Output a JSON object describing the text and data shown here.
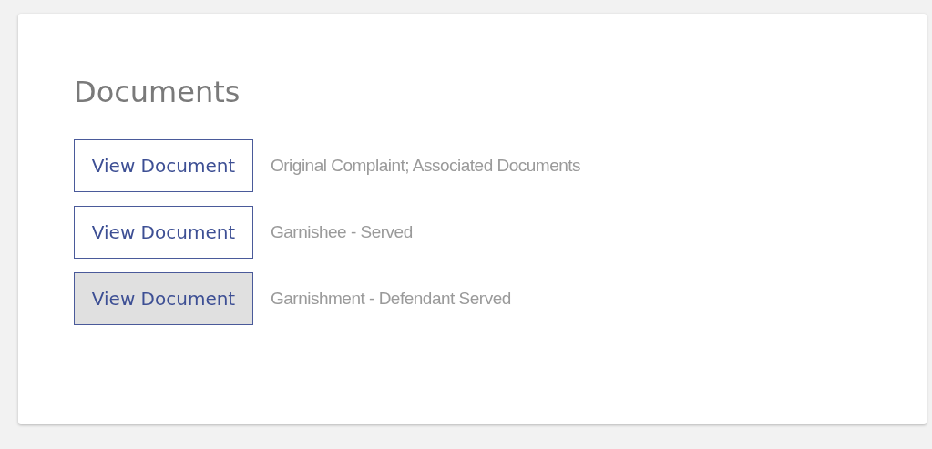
{
  "title": "Documents",
  "documents": [
    {
      "button": "View Document",
      "description": "Original Complaint; Associated Documents",
      "hovered": false
    },
    {
      "button": "View Document",
      "description": "Garnishee - Served",
      "hovered": false
    },
    {
      "button": "View Document",
      "description": "Garnishment - Defendant Served",
      "hovered": true
    }
  ]
}
